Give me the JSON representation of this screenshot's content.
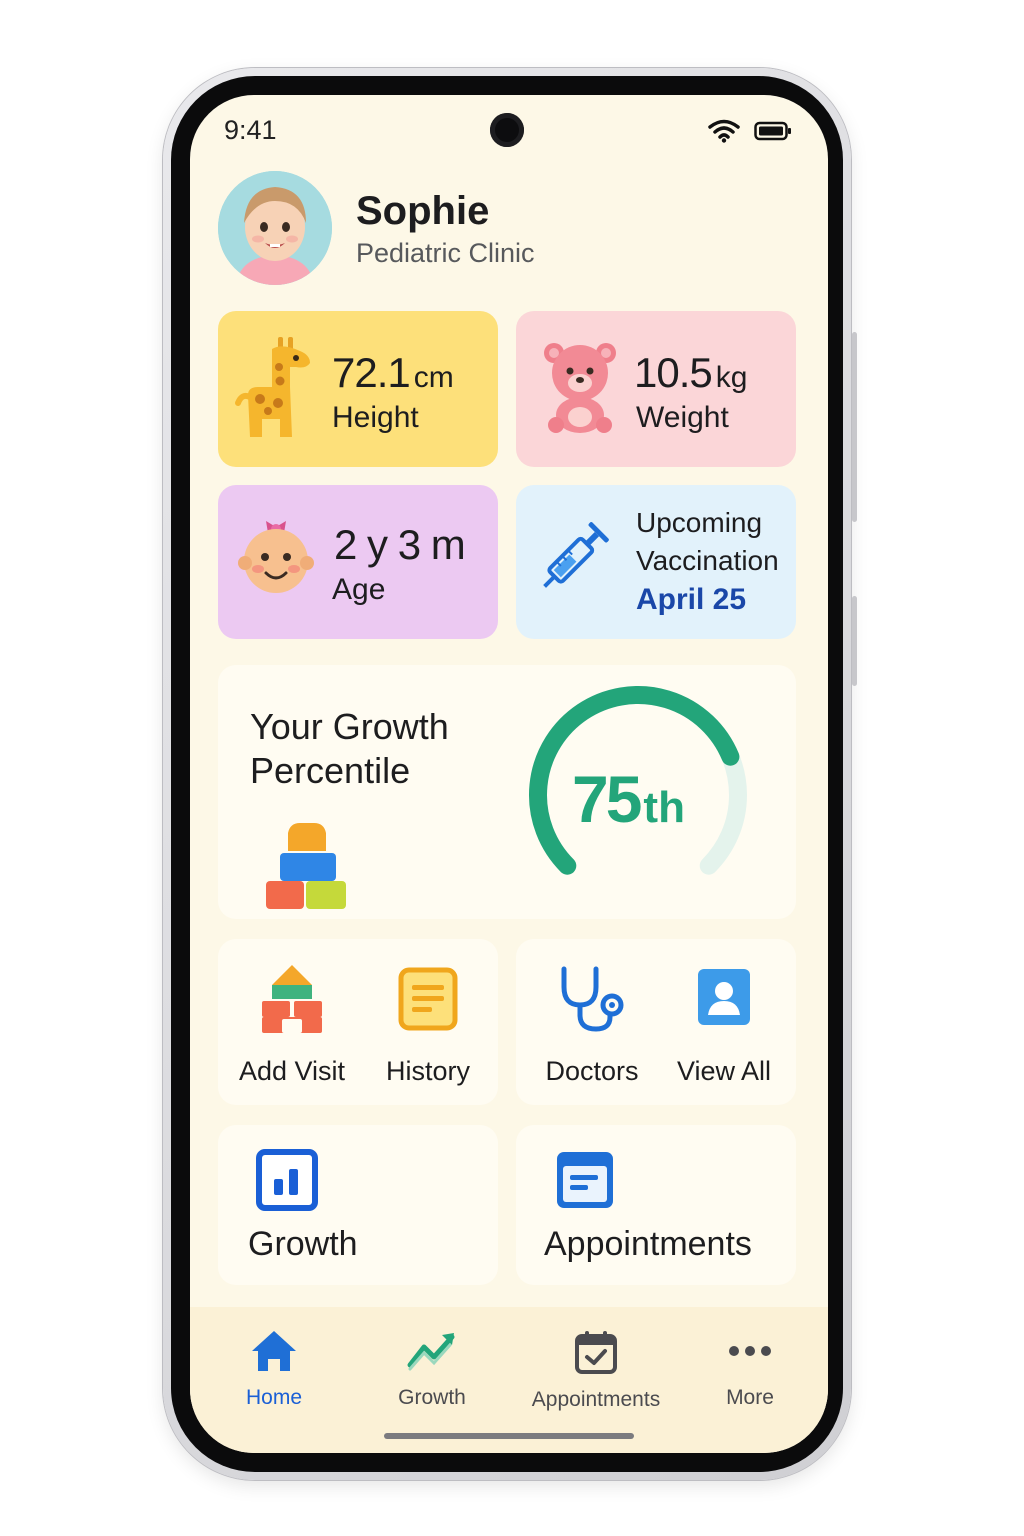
{
  "status_bar": {
    "time": "9:41"
  },
  "profile": {
    "name": "Sophie",
    "subtitle": "Pediatric Clinic"
  },
  "stats": {
    "height": {
      "value": "72.1",
      "unit": "cm",
      "label": "Height"
    },
    "weight": {
      "value": "10.5",
      "unit": "kg",
      "label": "Weight"
    },
    "age": {
      "value": "2 y 3 m",
      "label": "Age"
    },
    "vaccination": {
      "line1": "Upcoming",
      "line2": "Vaccination",
      "date": "April 25"
    }
  },
  "growth": {
    "title": "Your Growth Percentile",
    "percentile_number": "75",
    "percentile_suffix": "th",
    "gauge_fraction": 0.75
  },
  "actions": {
    "add_visit": "Add Visit",
    "history": "History",
    "doctors": "Doctors",
    "view_all": "View All",
    "growth": "Growth",
    "appointments": "Appointments"
  },
  "nav": [
    {
      "label": "Home",
      "icon": "home-icon",
      "active": true
    },
    {
      "label": "Growth",
      "icon": "trend-icon",
      "active": false
    },
    {
      "label": "Appointments",
      "icon": "calendar-check-icon",
      "active": false
    },
    {
      "label": "More",
      "icon": "more-dots-icon",
      "active": false
    }
  ],
  "colors": {
    "screen_bg": "#fdf8e7",
    "height_card": "#fde07a",
    "weight_card": "#fbd6d8",
    "age_card": "#ecc9f2",
    "vaccination_card": "#e2f2fb",
    "gauge_green": "#23a57a",
    "accent_blue": "#1a5fd6"
  }
}
